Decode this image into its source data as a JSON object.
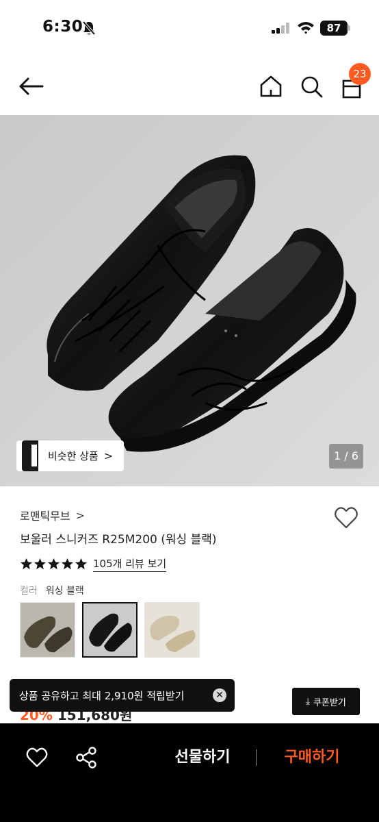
{
  "status_bar": {
    "time": "6:30",
    "battery": "87"
  },
  "nav": {
    "cart_count": "23"
  },
  "gallery": {
    "similar_label": "비슷한 상품",
    "similar_chevron": ">",
    "page_indicator": "1 / 6"
  },
  "product": {
    "brand": "로맨틱무브",
    "brand_chevron": ">",
    "title": "보울러 스니커즈 R25M200 (워싱 블랙)",
    "rating": 5,
    "review_link": "105개 리뷰 보기",
    "color_label": "컬러",
    "color_value": "워싱 블랙",
    "swatches": [
      "olive",
      "black",
      "beige"
    ],
    "price_percent": "20%",
    "price_amount": "151,680원"
  },
  "toast": {
    "text": "상품 공유하고 최대 2,910원 적립받기",
    "close": "✕"
  },
  "coupon": {
    "label": "쿠폰받기",
    "icon": "⤓"
  },
  "bottom_bar": {
    "gift_label": "선물하기",
    "buy_label": "구매하기"
  },
  "colors": {
    "accent": "#ff5a1f",
    "dark": "#111111"
  }
}
